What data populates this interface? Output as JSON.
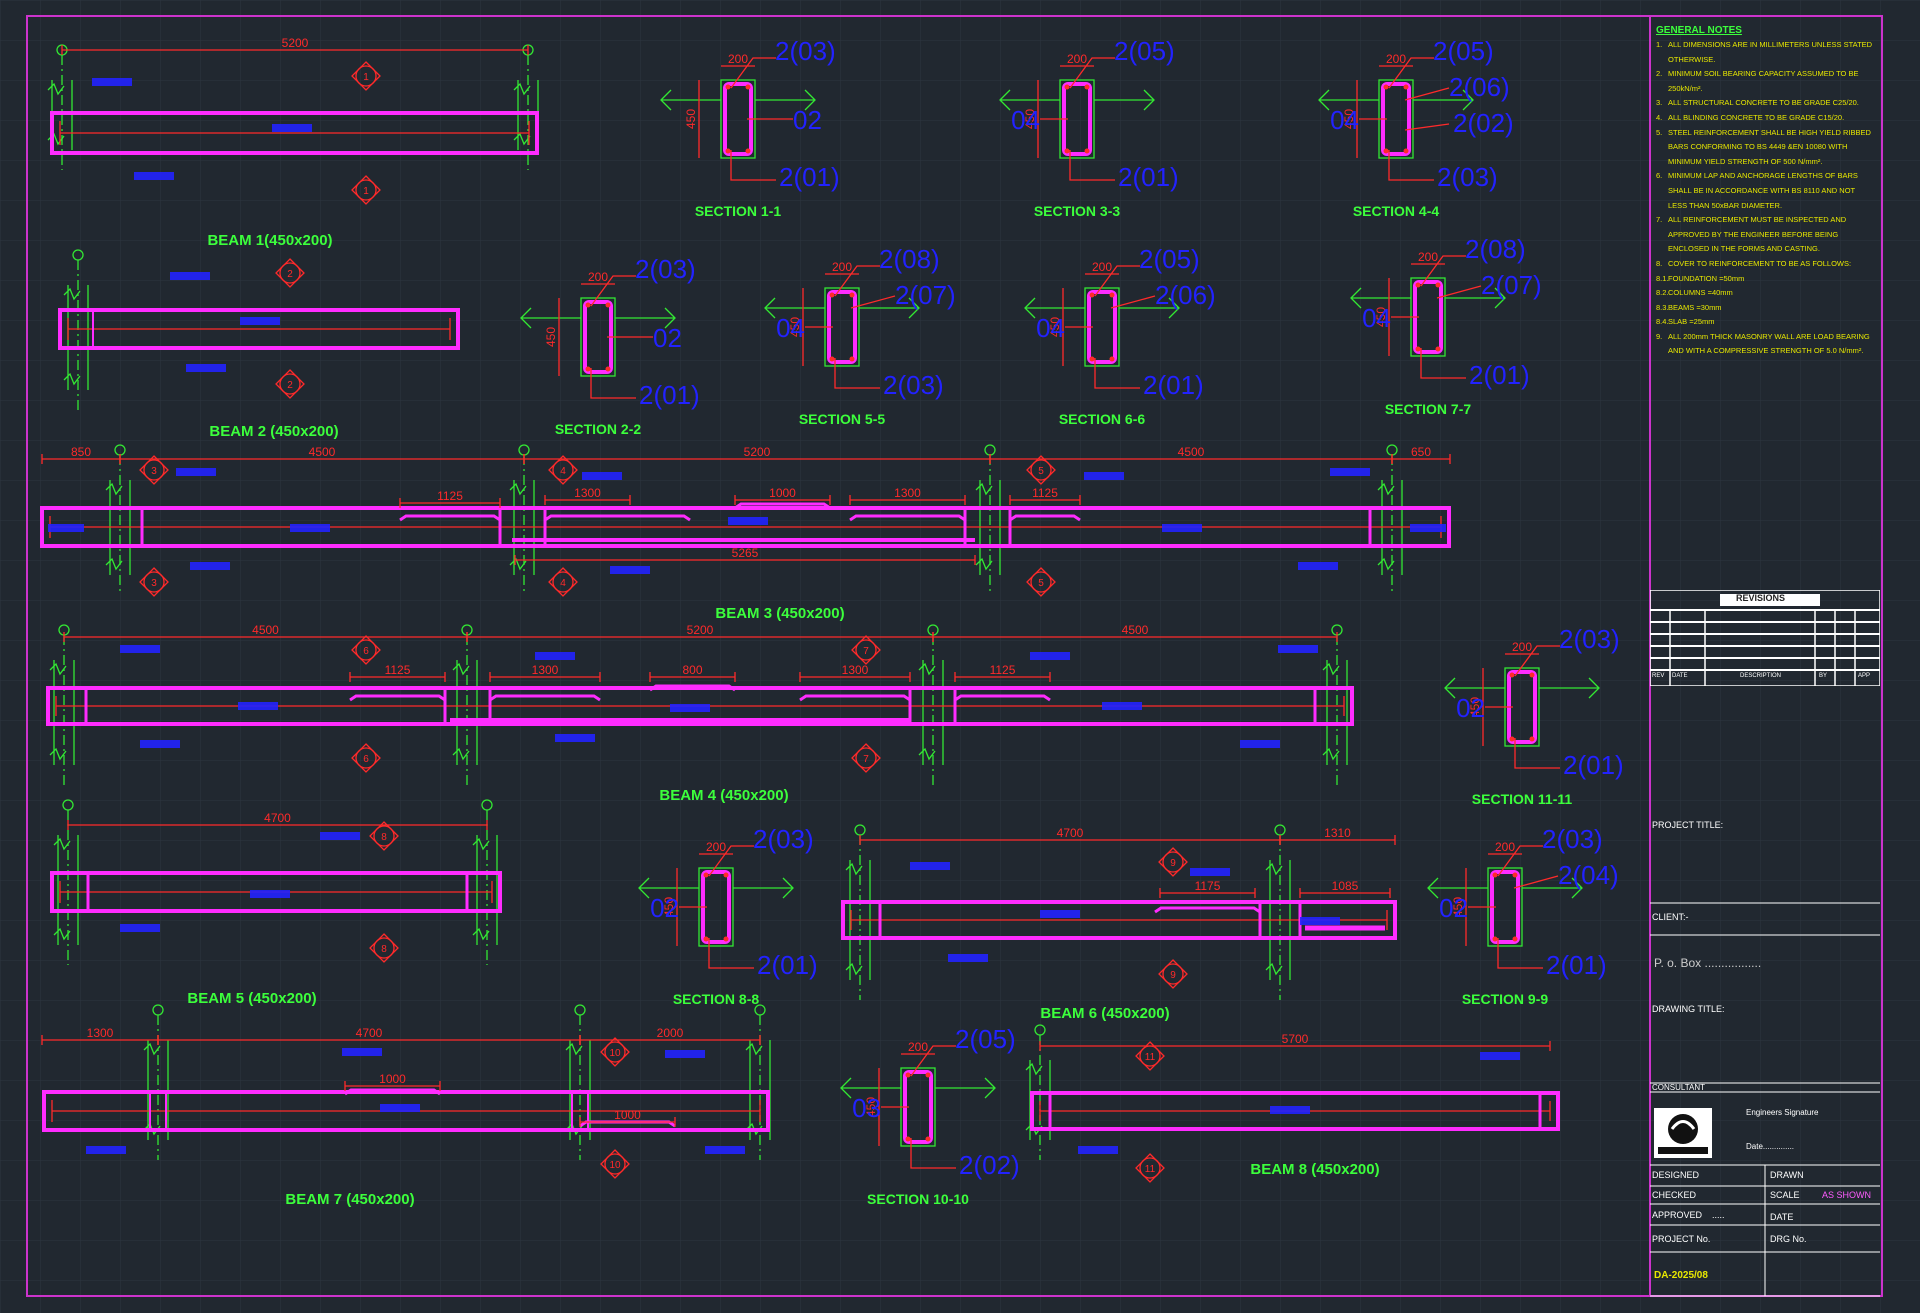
{
  "notes": {
    "title": "GENERAL NOTES",
    "items": [
      {
        "n": "1.",
        "t": "ALL DIMENSIONS ARE IN MILLIMETERS UNLESS STATED OTHERWISE."
      },
      {
        "n": "2.",
        "t": "MINIMUM SOIL BEARING CAPACITY ASSUMED TO BE 250kN/m²."
      },
      {
        "n": "3.",
        "t": "ALL STRUCTURAL CONCRETE TO BE GRADE C25/20."
      },
      {
        "n": "4.",
        "t": "ALL BLINDING CONCRETE TO BE GRADE C15/20."
      },
      {
        "n": "5.",
        "t": "STEEL REINFORCEMENT SHALL BE HIGH YIELD RIBBED BARS CONFORMING TO BS 4449 &EN 10080 WITH MINIMUM YIELD STRENGTH OF 500 N/mm²."
      },
      {
        "n": "6.",
        "t": "MINIMUM LAP AND ANCHORAGE LENGTHS OF BARS SHALL BE IN ACCORDANCE WITH BS 8110 AND NOT LESS THAN 50xBAR DIAMETER."
      },
      {
        "n": "7.",
        "t": "ALL REINFORCEMENT MUST BE INSPECTED AND APPROVED BY THE ENGINEER BEFORE BEING ENCLOSED IN THE FORMS AND CASTING."
      },
      {
        "n": "8.",
        "t": "COVER TO REINFORCEMENT TO BE AS FOLLOWS:"
      },
      {
        "n": "8.1.",
        "t": "FOUNDATION      =50mm"
      },
      {
        "n": "8.2.",
        "t": "COLUMNS         =40mm"
      },
      {
        "n": "8.3.",
        "t": "BEAMS           =30mm"
      },
      {
        "n": "8.4.",
        "t": "SLAB            =25mm"
      },
      {
        "n": "9.",
        "t": "ALL 200mm THICK MASONRY WALL ARE LOAD BEARING AND WITH A COMPRESSIVE STRENGTH OF 5.0 N/mm²."
      }
    ]
  },
  "beams": [
    {
      "label": "BEAM 1(450x200)",
      "span": "5200",
      "mark": "1"
    },
    {
      "label": "BEAM 2 (450x200)",
      "mark": "2"
    },
    {
      "label": "BEAM 3 (450x200)",
      "dims": [
        "850",
        "4500",
        "5200",
        "4500",
        "650"
      ],
      "laps": [
        "1125",
        "1300",
        "1000",
        "1300",
        "1125"
      ],
      "mid": "5265",
      "marks": [
        "3",
        "4",
        "5"
      ]
    },
    {
      "label": "BEAM 4 (450x200)",
      "dims": [
        "4500",
        "5200",
        "4500"
      ],
      "laps": [
        "1125",
        "1300",
        "800",
        "1300",
        "1125"
      ],
      "marks": [
        "6",
        "7"
      ]
    },
    {
      "label": "BEAM 5 (450x200)",
      "span": "4700",
      "mark": "8"
    },
    {
      "label": "BEAM 6 (450x200)",
      "dims": [
        "4700",
        "1310"
      ],
      "laps": [
        "1175",
        "1085"
      ],
      "mark": "9"
    },
    {
      "label": "BEAM 7 (450x200)",
      "dims": [
        "1300",
        "4700",
        "2000"
      ],
      "laps": [
        "1000",
        "1000"
      ],
      "mark": "10"
    },
    {
      "label": "BEAM 8 (450x200)",
      "span": "5700",
      "mark": "11"
    }
  ],
  "sections": [
    {
      "label": "SECTION 1-1",
      "w": "200",
      "h": "450",
      "top": "2(03)",
      "side": "02",
      "bot": "2(01)"
    },
    {
      "label": "SECTION 3-3",
      "w": "200",
      "h": "450",
      "top": "2(05)",
      "side": "04",
      "bot": "2(01)"
    },
    {
      "label": "SECTION 4-4",
      "w": "200",
      "h": "450",
      "top": "2(05)",
      "side": "04",
      "extra1": "2(06)",
      "extra2": "2(02)",
      "bot": "2(03)"
    },
    {
      "label": "SECTION 2-2",
      "w": "200",
      "h": "450",
      "top": "2(03)",
      "side": "02",
      "bot": "2(01)"
    },
    {
      "label": "SECTION 5-5",
      "w": "200",
      "h": "450",
      "top": "2(08)",
      "side": "04",
      "extra1": "2(07)",
      "bot": "2(03)"
    },
    {
      "label": "SECTION 6-6",
      "w": "200",
      "h": "450",
      "top": "2(05)",
      "side": "04",
      "extra1": "2(06)",
      "bot": "2(01)"
    },
    {
      "label": "SECTION 7-7",
      "w": "200",
      "h": "450",
      "top": "2(08)",
      "side": "04",
      "extra1": "2(07)",
      "bot": "2(01)"
    },
    {
      "label": "SECTION 11-11",
      "w": "200",
      "h": "450",
      "top": "2(03)",
      "side": "02",
      "bot": "2(01)"
    },
    {
      "label": "SECTION 8-8",
      "w": "200",
      "h": "450",
      "top": "2(03)",
      "side": "02",
      "bot": "2(01)"
    },
    {
      "label": "SECTION 9-9",
      "w": "200",
      "h": "450",
      "top": "2(03)",
      "side": "02",
      "extra1": "2(04)",
      "bot": "2(01)"
    },
    {
      "label": "SECTION 10-10",
      "w": "200",
      "h": "450",
      "top": "2(05)",
      "side": "03",
      "bot": "2(02)"
    }
  ],
  "titleblock": {
    "revisions": "REVISIONS",
    "rev_cols": [
      "REV",
      "DATE",
      "DESCRIPTION",
      "BY",
      "APP"
    ],
    "project_title": "PROJECT TITLE:",
    "client": "CLIENT:-",
    "pobox": "P. o. Box  .................",
    "drawing_title": "DRAWING TITLE:",
    "consultant": "CONSULTANT",
    "eng_sig": "Engineers Signature",
    "date_line": "Date..............",
    "designed": "DESIGNED",
    "drawn": "DRAWN",
    "checked": "CHECKED",
    "scale": "SCALE",
    "scale_val": "AS SHOWN",
    "approved": "APPROVED",
    "approved_val": ".....",
    "date": "DATE",
    "project_no": "PROJECT No.",
    "drg_no": "DRG No.",
    "drg_val": "DA-2025/08"
  },
  "colors": {
    "bg": "#212830",
    "beam": "#ff2cff",
    "dim": "#ff2a2a",
    "column": "#33e833",
    "tag": "#2222ff",
    "title": "#3cff3c",
    "note": "#e8e800",
    "frame": "#cc33cc"
  }
}
